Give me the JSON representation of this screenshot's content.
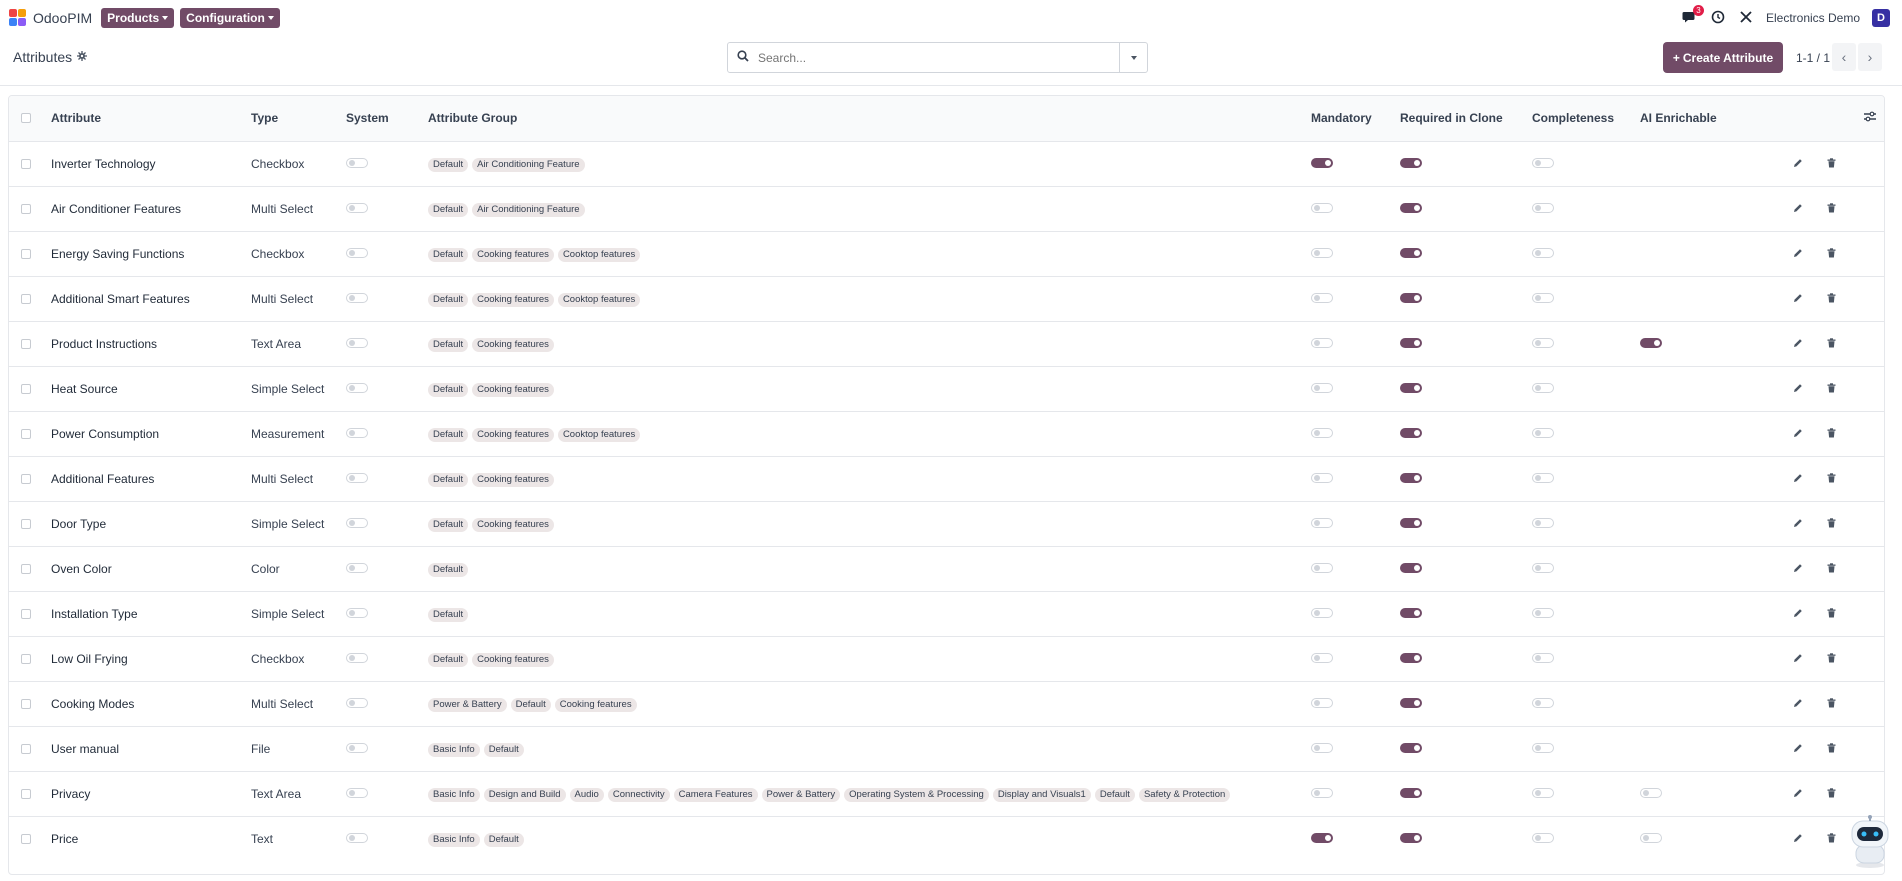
{
  "app": {
    "name": "OdooPIM"
  },
  "menus": [
    {
      "label": "Products"
    },
    {
      "label": "Configuration"
    }
  ],
  "header_right": {
    "message_count": "3",
    "company": "Electronics Demo",
    "avatar_letter": "D"
  },
  "breadcrumb": {
    "title": "Attributes"
  },
  "search": {
    "placeholder": "Search..."
  },
  "create_button": "Create Attribute",
  "pager": "1-1 / 1",
  "columns": {
    "attribute": "Attribute",
    "type": "Type",
    "system": "System",
    "group": "Attribute Group",
    "mandatory": "Mandatory",
    "clone": "Required in Clone",
    "completeness": "Completeness",
    "ai": "AI Enrichable"
  },
  "accent_color": "#714b67",
  "rows": [
    {
      "name": "Inverter Technology",
      "type": "Checkbox",
      "groups": [
        "Default",
        "Air Conditioning Feature"
      ],
      "system": false,
      "mandatory": true,
      "clone": true,
      "completeness": false,
      "ai": null
    },
    {
      "name": "Air Conditioner Features",
      "type": "Multi Select",
      "groups": [
        "Default",
        "Air Conditioning Feature"
      ],
      "system": false,
      "mandatory": false,
      "clone": true,
      "completeness": false,
      "ai": null
    },
    {
      "name": "Energy Saving Functions",
      "type": "Checkbox",
      "groups": [
        "Default",
        "Cooking features",
        "Cooktop features"
      ],
      "system": false,
      "mandatory": false,
      "clone": true,
      "completeness": false,
      "ai": null
    },
    {
      "name": "Additional Smart Features",
      "type": "Multi Select",
      "groups": [
        "Default",
        "Cooking features",
        "Cooktop features"
      ],
      "system": false,
      "mandatory": false,
      "clone": true,
      "completeness": false,
      "ai": null
    },
    {
      "name": "Product Instructions",
      "type": "Text Area",
      "groups": [
        "Default",
        "Cooking features"
      ],
      "system": false,
      "mandatory": false,
      "clone": true,
      "completeness": false,
      "ai": true
    },
    {
      "name": "Heat Source",
      "type": "Simple Select",
      "groups": [
        "Default",
        "Cooking features"
      ],
      "system": false,
      "mandatory": false,
      "clone": true,
      "completeness": false,
      "ai": null
    },
    {
      "name": "Power Consumption",
      "type": "Measurement",
      "groups": [
        "Default",
        "Cooking features",
        "Cooktop features"
      ],
      "system": false,
      "mandatory": false,
      "clone": true,
      "completeness": false,
      "ai": null
    },
    {
      "name": "Additional Features",
      "type": "Multi Select",
      "groups": [
        "Default",
        "Cooking features"
      ],
      "system": false,
      "mandatory": false,
      "clone": true,
      "completeness": false,
      "ai": null
    },
    {
      "name": "Door Type",
      "type": "Simple Select",
      "groups": [
        "Default",
        "Cooking features"
      ],
      "system": false,
      "mandatory": false,
      "clone": true,
      "completeness": false,
      "ai": null
    },
    {
      "name": "Oven Color",
      "type": "Color",
      "groups": [
        "Default"
      ],
      "system": false,
      "mandatory": false,
      "clone": true,
      "completeness": false,
      "ai": null
    },
    {
      "name": "Installation Type",
      "type": "Simple Select",
      "groups": [
        "Default"
      ],
      "system": false,
      "mandatory": false,
      "clone": true,
      "completeness": false,
      "ai": null
    },
    {
      "name": "Low Oil Frying",
      "type": "Checkbox",
      "groups": [
        "Default",
        "Cooking features"
      ],
      "system": false,
      "mandatory": false,
      "clone": true,
      "completeness": false,
      "ai": null
    },
    {
      "name": "Cooking Modes",
      "type": "Multi Select",
      "groups": [
        "Power & Battery",
        "Default",
        "Cooking features"
      ],
      "system": false,
      "mandatory": false,
      "clone": true,
      "completeness": false,
      "ai": null
    },
    {
      "name": "User manual",
      "type": "File",
      "groups": [
        "Basic Info",
        "Default"
      ],
      "system": false,
      "mandatory": false,
      "clone": true,
      "completeness": false,
      "ai": null
    },
    {
      "name": "Privacy",
      "type": "Text Area",
      "groups": [
        "Basic Info",
        "Design and Build",
        "Audio",
        "Connectivity",
        "Camera Features",
        "Power & Battery",
        "Operating System & Processing",
        "Display and Visuals1",
        "Default",
        "Safety & Protection"
      ],
      "system": false,
      "mandatory": false,
      "clone": true,
      "completeness": false,
      "ai": false
    },
    {
      "name": "Price",
      "type": "Text",
      "groups": [
        "Basic Info",
        "Default"
      ],
      "system": false,
      "mandatory": true,
      "clone": true,
      "completeness": false,
      "ai": false
    }
  ]
}
